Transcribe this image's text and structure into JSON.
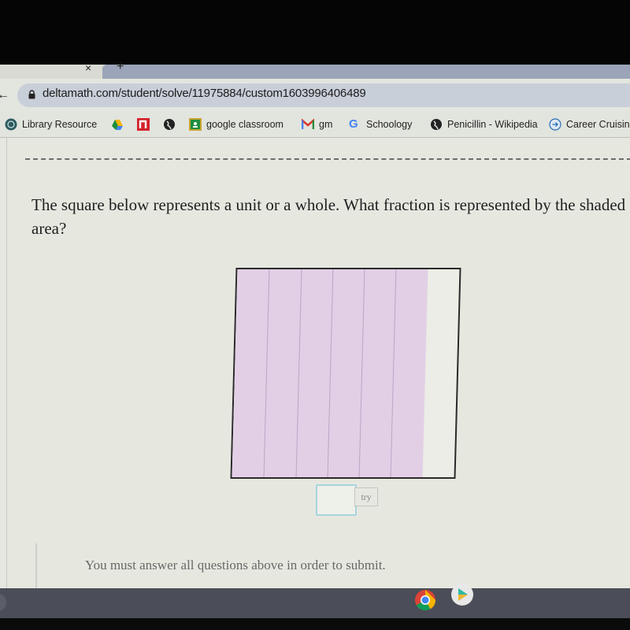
{
  "browser": {
    "url": "deltamath.com/student/solve/11975884/custom1603996406489",
    "icons": {
      "tab_close": "close-icon",
      "new_tab": "plus-icon",
      "back": "back-arrow-icon",
      "lock": "lock-icon"
    },
    "tab_close_glyph": "×",
    "new_tab_glyph": "+",
    "back_glyph": "←"
  },
  "bookmarks": [
    {
      "label": "Library Resource",
      "icon": "library-icon"
    },
    {
      "label": "",
      "icon": "google-drive-icon"
    },
    {
      "label": "",
      "icon": "n-icon"
    },
    {
      "label": "",
      "icon": "globe-icon"
    },
    {
      "label": "google classroom",
      "icon": "google-classroom-icon"
    },
    {
      "label": "gm",
      "icon": "gmail-icon"
    },
    {
      "label": "Schoology",
      "icon": "google-icon"
    },
    {
      "label": "Penicillin - Wikipedia",
      "icon": "globe-icon"
    },
    {
      "label": "Career Cruising",
      "icon": "arrow-circle-icon"
    }
  ],
  "problem": {
    "question": "The square below represents a unit or a whole. What fraction is represented by the shaded area?",
    "model": {
      "total_parts": 7,
      "shaded_parts": 6,
      "shaded_fraction": "6/7",
      "orientation": "vertical columns"
    },
    "answer_value": "",
    "try_label": "try",
    "footer_note": "You must answer all questions above in order to submit."
  },
  "colors": {
    "shaded": "#e2cfe6",
    "divider": "#b8a6c4",
    "answer_border": "#a8d4da",
    "shelf": "#4b4d58"
  },
  "shelf": {
    "apps": [
      {
        "name": "Chrome",
        "icon": "chrome-icon"
      },
      {
        "name": "Play Store",
        "icon": "play-store-icon"
      }
    ]
  }
}
